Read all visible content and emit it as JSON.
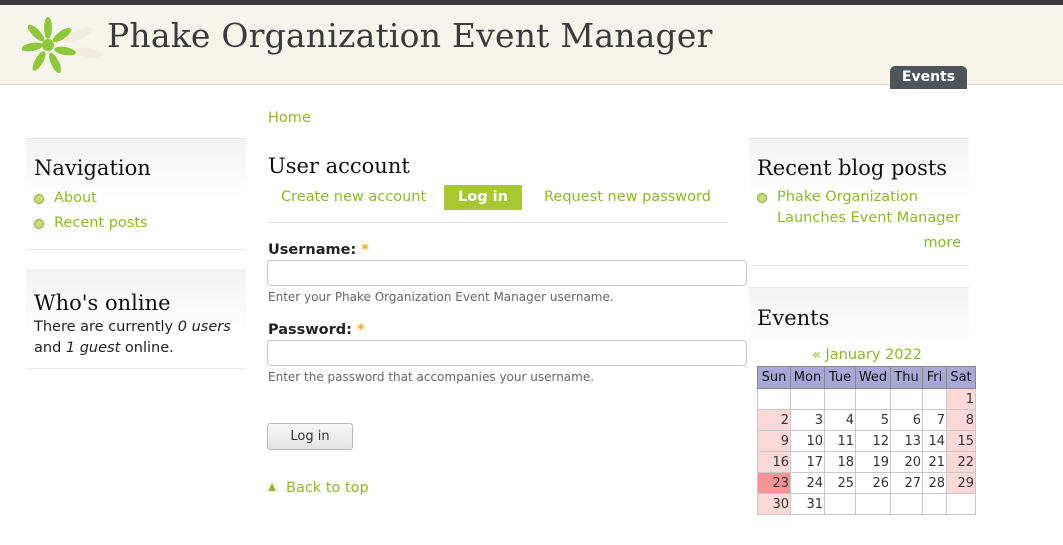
{
  "site": {
    "name": "Phake Organization Event Manager"
  },
  "primary_tabs": [
    {
      "label": "Events"
    }
  ],
  "breadcrumb": {
    "home": "Home"
  },
  "sidebar_left": {
    "navigation": {
      "title": "Navigation",
      "items": [
        {
          "label": "About"
        },
        {
          "label": "Recent posts"
        }
      ]
    },
    "whos_online": {
      "title": "Who's online",
      "text_1": "There are currently ",
      "users": "0 users",
      "text_2": "and ",
      "guests": "1 guest",
      "text_3": " online."
    }
  },
  "main": {
    "title": "User account",
    "tabs": [
      {
        "label": "Create new account"
      },
      {
        "label": "Log in"
      },
      {
        "label": "Request new password"
      }
    ],
    "username": {
      "label": "Username:",
      "required_mark": "*",
      "value": "",
      "description": "Enter your Phake Organization Event Manager username."
    },
    "password": {
      "label": "Password:",
      "required_mark": "*",
      "value": "",
      "description": "Enter the password that accompanies your username."
    },
    "submit_label": "Log in",
    "back_to_top": "Back to top"
  },
  "sidebar_right": {
    "blog": {
      "title": "Recent blog posts",
      "post_line_1": "Phake Organization",
      "post_line_2": "Launches Event Manager",
      "more": "more"
    },
    "events": {
      "title": "Events",
      "month_label": "« January 2022",
      "weekdays": [
        "Sun",
        "Mon",
        "Tue",
        "Wed",
        "Thu",
        "Fri",
        "Sat"
      ],
      "weeks": [
        [
          "",
          "",
          "",
          "",
          "",
          "",
          "1"
        ],
        [
          "2",
          "3",
          "4",
          "5",
          "6",
          "7",
          "8"
        ],
        [
          "9",
          "10",
          "11",
          "12",
          "13",
          "14",
          "15"
        ],
        [
          "16",
          "17",
          "18",
          "19",
          "20",
          "21",
          "22"
        ],
        [
          "23",
          "24",
          "25",
          "26",
          "27",
          "28",
          "29"
        ],
        [
          "30",
          "31",
          "",
          "",
          "",
          "",
          ""
        ]
      ],
      "today": "23"
    }
  },
  "colors": {
    "accent": "#8db825",
    "active_tab": "#a8c832",
    "header_bg": "#f6f4ea",
    "tab_dark": "#4f5458",
    "weekend": "#fdd8d8",
    "today": "#f59494"
  }
}
